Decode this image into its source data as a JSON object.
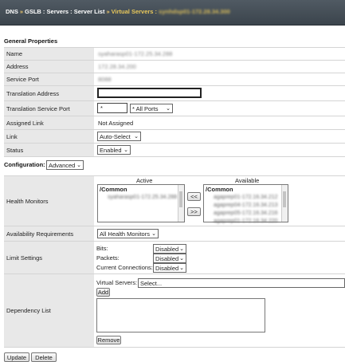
{
  "breadcrumb": {
    "items": [
      "DNS",
      "GSLB : Servers : Server List",
      "Virtual Servers :"
    ],
    "separator": "»",
    "current_value": "synhdsp01-172.28.34.300"
  },
  "general": {
    "title": "General Properties",
    "rows": {
      "name": {
        "label": "Name",
        "value": "syaharasp01-172.25.34.288"
      },
      "address": {
        "label": "Address",
        "value": "172.28.34.200"
      },
      "service_port": {
        "label": "Service Port",
        "value": "8088"
      },
      "translation_address": {
        "label": "Translation Address",
        "value": ""
      },
      "translation_service_port": {
        "label": "Translation Service Port",
        "value": "*",
        "select": "* All Ports"
      },
      "assigned_link": {
        "label": "Assigned Link",
        "value": "Not Assigned"
      },
      "link": {
        "label": "Link",
        "select": "Auto-Select"
      },
      "status": {
        "label": "Status",
        "select": "Enabled"
      }
    }
  },
  "configuration": {
    "label": "Configuration:",
    "mode": "Advanced",
    "health_monitors": {
      "label": "Health Monitors",
      "active_header": "Active",
      "available_header": "Available",
      "active_group": "/Common",
      "active_items": [
        "syaharasp01-172.25.34.288"
      ],
      "available_group": "/Common",
      "available_items": [
        "agaprep01-172.16.34.212",
        "agaprep04-172.16.34.213",
        "agaprep05-172.16.34.216",
        "agaprep01-172.16.34.220"
      ],
      "move_left": "<<",
      "move_right": ">>"
    },
    "availability": {
      "label": "Availability Requirements",
      "select": "All Health Monitors"
    },
    "limits": {
      "label": "Limit Settings",
      "bits_label": "Bits:",
      "bits_value": "Disabled",
      "packets_label": "Packets:",
      "packets_value": "Disabled",
      "conn_label": "Current Connections:",
      "conn_value": "Disabled"
    },
    "dependency": {
      "label": "Dependency List",
      "vs_label": "Virtual Servers:",
      "vs_select": "Select...",
      "add": "Add",
      "remove": "Remove"
    }
  },
  "actions": {
    "update": "Update",
    "delete": "Delete"
  }
}
